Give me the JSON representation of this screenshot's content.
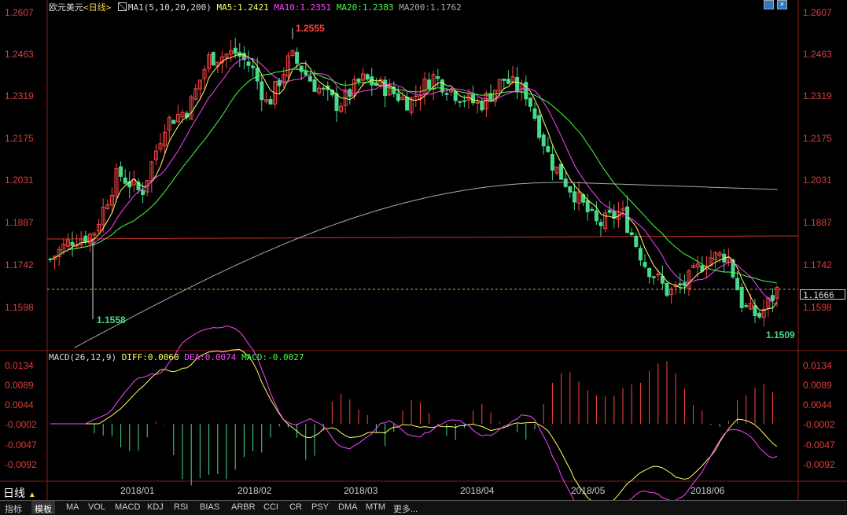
{
  "header": {
    "symbol": "欧元美元",
    "period": "<日线>",
    "ma_icon": "grid-icon",
    "ma_name": "MA1(5,10,20,200)",
    "ma5": "MA5:1.2421",
    "ma10": "MA10:1.2351",
    "ma20": "MA20:1.2383",
    "ma200": "MA200:1.1762"
  },
  "macd_header": {
    "name": "MACD(26,12,9)",
    "diff": "DIFF:0.0060",
    "dea": "DEA:0.0074",
    "macd": "MACD:-0.0027"
  },
  "price_axis": [
    "1.2607",
    "1.2463",
    "1.2319",
    "1.2175",
    "1.2031",
    "1.1887",
    "1.1742",
    "1.1598"
  ],
  "macd_axis": [
    "0.0134",
    "0.0089",
    "0.0044",
    "-0.0002",
    "-0.0047",
    "-0.0092"
  ],
  "current_price": "1.1666",
  "annotations": {
    "high": "1.2555",
    "low1": "1.1558",
    "low2": "1.1509"
  },
  "months": [
    "2018/01",
    "2018/02",
    "2018/03",
    "2018/04",
    "2018/05",
    "2018/06"
  ],
  "period_label": "日线",
  "tabs": [
    "指标",
    "模板",
    "MA",
    "VOL",
    "MACD",
    "KDJ",
    "RSI",
    "BIAS",
    "ARBR",
    "CCI",
    "CR",
    "PSY",
    "DMA",
    "MTM",
    "更多..."
  ],
  "colors": {
    "up": "#ff4545",
    "down": "#48d98c",
    "ma5": "#ffff66",
    "ma10": "#ff44ff",
    "ma20": "#44ff44",
    "ma200": "#aaaaaa",
    "axis": "#e03c3c"
  },
  "window_icons": [
    "restore-icon",
    "close-icon"
  ]
}
